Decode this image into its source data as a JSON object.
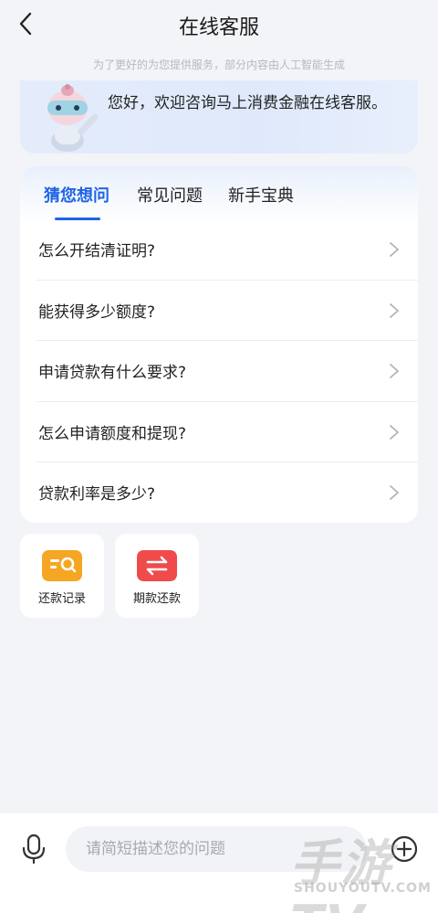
{
  "header": {
    "title": "在线客服",
    "subtitle": "为了更好的为您提供服务，部分内容由人工智能生成"
  },
  "welcome": {
    "text": "您好，欢迎咨询马上消费金融在线客服。"
  },
  "tabs": [
    {
      "label": "猜您想问",
      "active": true
    },
    {
      "label": "常见问题",
      "active": false
    },
    {
      "label": "新手宝典",
      "active": false
    }
  ],
  "faq": [
    "怎么开结清证明?",
    "能获得多少额度?",
    "申请贷款有什么要求?",
    "怎么申请额度和提现?",
    "贷款利率是多少?"
  ],
  "shortcuts": [
    {
      "label": "还款记录",
      "icon": "search-record-icon",
      "color": "#f5a623"
    },
    {
      "label": "期款还款",
      "icon": "swap-arrows-icon",
      "color": "#f04b4b"
    }
  ],
  "input": {
    "placeholder": "请简短描述您的问题"
  },
  "watermark": {
    "main": "手游TV",
    "sub": "SHOUYOUTV.COM"
  },
  "colors": {
    "accent": "#1f64e6",
    "background": "#f3f4f8"
  }
}
